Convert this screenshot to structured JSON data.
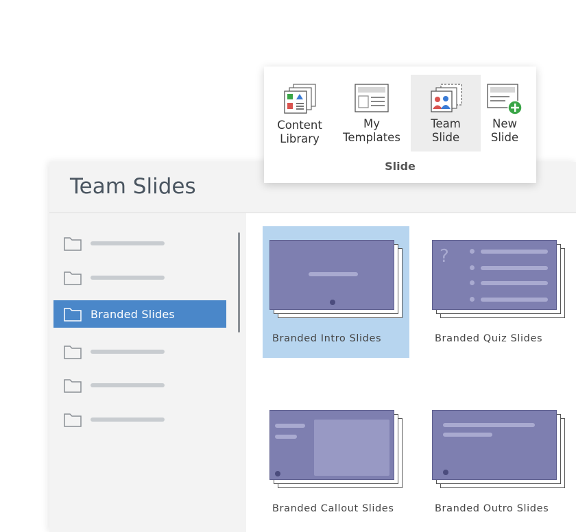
{
  "pane": {
    "title": "Team Slides"
  },
  "sidebar": {
    "items": [
      {
        "label": "",
        "selected": false
      },
      {
        "label": "",
        "selected": false
      },
      {
        "label": "Branded Slides",
        "selected": true
      },
      {
        "label": "",
        "selected": false
      },
      {
        "label": "",
        "selected": false
      },
      {
        "label": "",
        "selected": false
      }
    ]
  },
  "cards": [
    {
      "label": "Branded Intro Slides",
      "selected": true
    },
    {
      "label": "Branded Quiz Slides",
      "selected": false
    },
    {
      "label": "Branded Callout Slides",
      "selected": false
    },
    {
      "label": "Branded Outro Slides",
      "selected": false
    }
  ],
  "ribbon": {
    "group_label": "Slide",
    "buttons": [
      {
        "line1": "Content",
        "line2": "Library",
        "icon": "content-library-icon",
        "active": false
      },
      {
        "line1": "My",
        "line2": "Templates",
        "icon": "my-templates-icon",
        "active": false
      },
      {
        "line1": "Team",
        "line2": "Slide",
        "icon": "team-slide-icon",
        "active": true
      },
      {
        "line1": "New",
        "line2": "Slide",
        "icon": "new-slide-icon",
        "active": false
      }
    ]
  },
  "colors": {
    "accent": "#4a87c9",
    "selection": "#b7d5ef",
    "slide": "#7e7fb0",
    "add_badge": "#3aa547"
  },
  "quiz_card_symbol": "?"
}
